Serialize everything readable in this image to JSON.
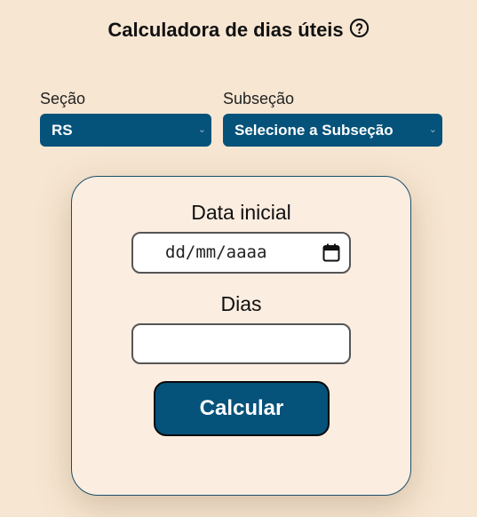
{
  "header": {
    "title": "Calculadora de dias úteis",
    "help_icon": "question-circle-icon"
  },
  "secao": {
    "label": "Seção",
    "selected": "RS"
  },
  "subsecao": {
    "label": "Subseção",
    "selected": "Selecione a Subseção"
  },
  "form": {
    "data_inicial_label": "Data inicial",
    "data_inicial_placeholder": "dd/mm/aaaa",
    "data_inicial_value": "",
    "dias_label": "Dias",
    "dias_value": "",
    "calcular_label": "Calcular"
  },
  "colors": {
    "background": "#f7e6d2",
    "card": "#fbede0",
    "accent": "#05527a"
  }
}
